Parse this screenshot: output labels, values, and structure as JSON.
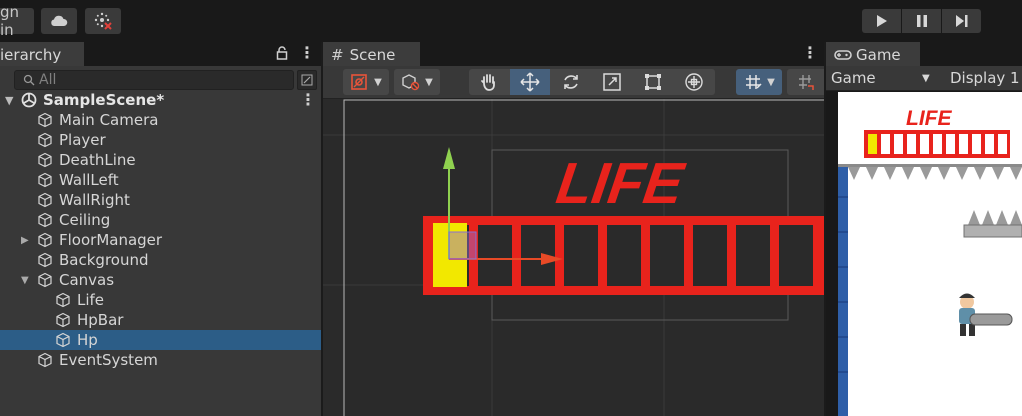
{
  "top": {
    "signin_label": "gn in",
    "cloud_icon": "cloud-icon",
    "collab_icon": "collab-icon",
    "play_icon": "play-icon",
    "pause_icon": "pause-icon",
    "step_icon": "step-icon"
  },
  "hierarchy": {
    "tab_label": "ierarchy",
    "search_placeholder": "All",
    "scene_name": "SampleScene*",
    "items": [
      {
        "label": "Main Camera"
      },
      {
        "label": "Player"
      },
      {
        "label": "DeathLine"
      },
      {
        "label": "WallLeft"
      },
      {
        "label": "WallRight"
      },
      {
        "label": "Ceiling"
      },
      {
        "label": "FloorManager"
      },
      {
        "label": "Background"
      },
      {
        "label": "Canvas"
      },
      {
        "label": "Life"
      },
      {
        "label": "HpBar"
      },
      {
        "label": "Hp"
      },
      {
        "label": "EventSystem"
      }
    ],
    "selected": "Hp"
  },
  "scene": {
    "tab_label": "Scene",
    "life_text": "LIFE"
  },
  "game": {
    "tab_label": "Game",
    "view_label": "Game",
    "display_label": "Display 1",
    "life_text": "LIFE"
  },
  "colors": {
    "selection": "#2c5d87",
    "hp_red": "#e8231c",
    "hp_yellow": "#f2e800",
    "gizmo_green": "#8fd14f",
    "gizmo_red": "#e84a26"
  }
}
